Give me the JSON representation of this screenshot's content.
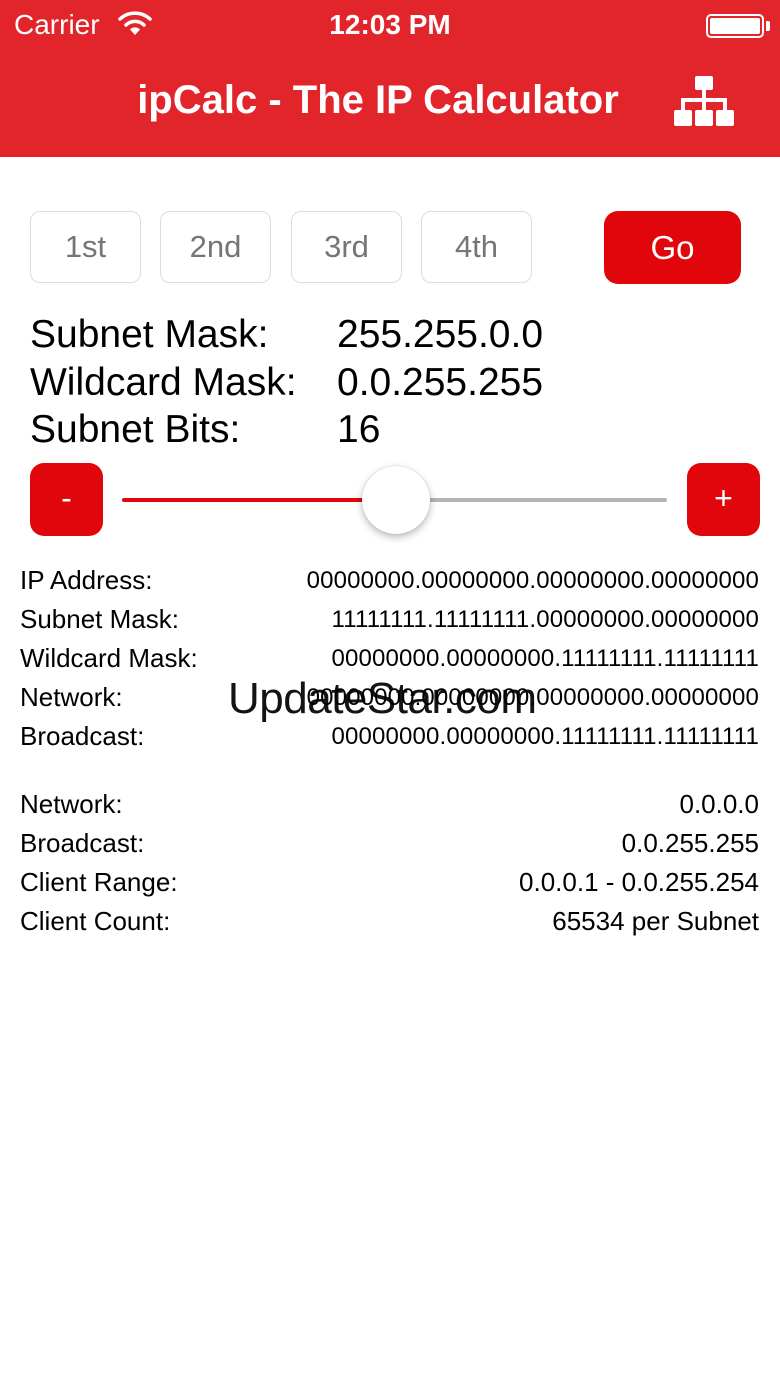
{
  "status_bar": {
    "carrier": "Carrier",
    "time": "12:03 PM",
    "icons": [
      "wifi-icon",
      "battery-icon"
    ]
  },
  "nav_bar": {
    "title": "ipCalc - The IP Calculator",
    "right_icon": "network-hierarchy-icon",
    "color": "#e2252b"
  },
  "octet_inputs": [
    {
      "placeholder": "1st",
      "value": ""
    },
    {
      "placeholder": "2nd",
      "value": ""
    },
    {
      "placeholder": "3rd",
      "value": ""
    },
    {
      "placeholder": "4th",
      "value": ""
    }
  ],
  "go_button": {
    "label": "Go"
  },
  "mask_info": {
    "subnet_mask": {
      "label": "Subnet Mask:",
      "value": "255.255.0.0"
    },
    "wildcard_mask": {
      "label": "Wildcard Mask:",
      "value": "0.0.255.255"
    },
    "subnet_bits": {
      "label": "Subnet Bits:",
      "value": "16"
    }
  },
  "bits_slider": {
    "decrement_label": "-",
    "increment_label": "+",
    "value": 16,
    "min": 0,
    "max": 32,
    "accent_color": "#e0060b"
  },
  "binary_table": [
    {
      "label": "IP Address:",
      "value": "00000000.00000000.00000000.00000000"
    },
    {
      "label": "Subnet Mask:",
      "value": "11111111.11111111.00000000.00000000"
    },
    {
      "label": "Wildcard Mask:",
      "value": "00000000.00000000.11111111.11111111"
    },
    {
      "label": "Network:",
      "value": "00000000.00000000.00000000.00000000"
    },
    {
      "label": "Broadcast:",
      "value": "00000000.00000000.11111111.11111111"
    }
  ],
  "summary": [
    {
      "label": "Network:",
      "value": "0.0.0.0"
    },
    {
      "label": "Broadcast:",
      "value": "0.0.255.255"
    },
    {
      "label": "Client Range:",
      "value": "0.0.0.1 - 0.0.255.254"
    },
    {
      "label": "Client Count:",
      "value": "65534 per Subnet"
    }
  ],
  "watermark": "UpdateStar.com"
}
